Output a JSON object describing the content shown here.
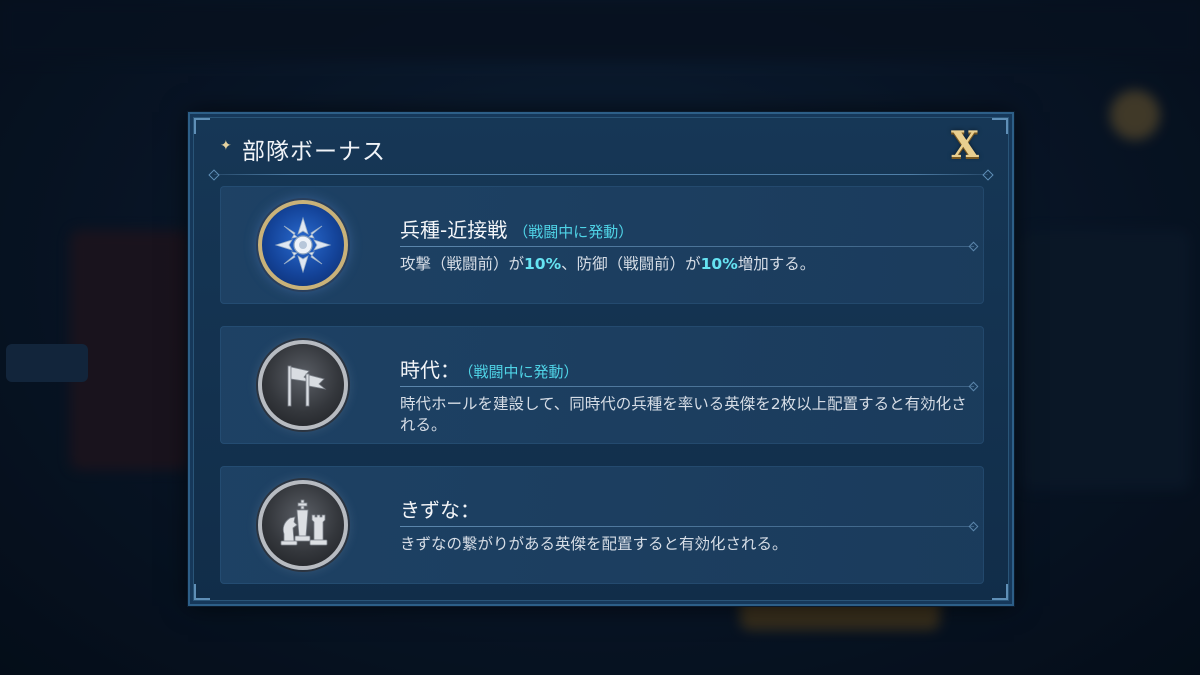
{
  "dialog": {
    "title": "部隊ボーナス",
    "close_label": "X"
  },
  "bonuses": [
    {
      "icon": "blue-cross-medal-icon",
      "title": "兵種-近接戦",
      "tag": "（戦闘中に発動）",
      "desc": [
        "攻撃（戦闘前）が",
        "10%",
        "、防御（戦闘前）が",
        "10%",
        "増加する。"
      ]
    },
    {
      "icon": "flag-medal-icon",
      "title": "時代：",
      "tag": "（戦闘中に発動）",
      "desc": "時代ホールを建設して、同時代の兵種を率いる英傑を2枚以上配置すると有効化される。"
    },
    {
      "icon": "chess-pieces-medal-icon",
      "title": "きずな：",
      "desc": "きずなの繋がりがある英傑を配置すると有効化される。"
    }
  ],
  "colors": {
    "accent": "#66e3f2",
    "tag": "#4fd3e6",
    "gold": "#e9cf8f",
    "panel": "#1e4265"
  }
}
